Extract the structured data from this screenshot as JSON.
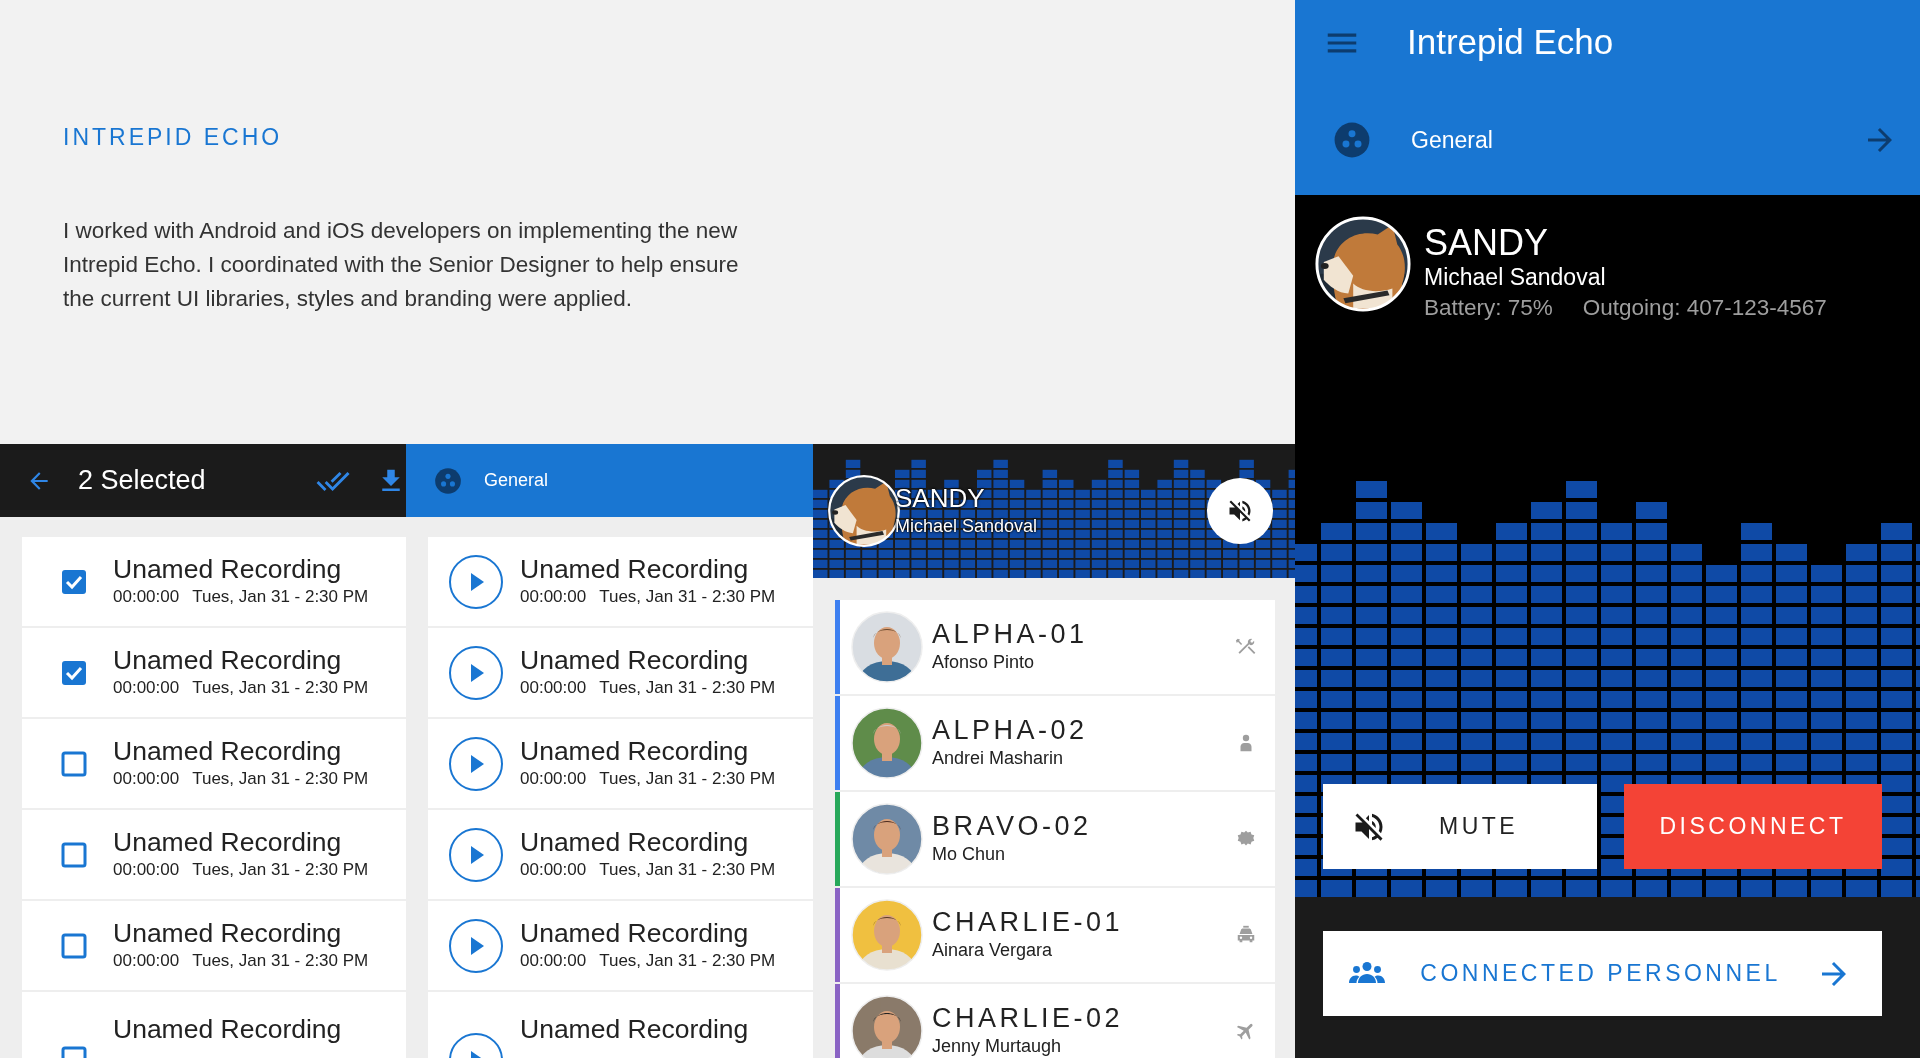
{
  "intro": {
    "heading": "INTREPID ECHO",
    "text": "I worked with Android and iOS developers on implementing the new Intrepid Echo. I coordinated with the Senior Designer to help ensure the current UI libraries, styles and branding were applied."
  },
  "selection_screen": {
    "title": "2 Selected",
    "recordings": [
      {
        "title": "Unamed Recording",
        "duration": "00:00:00",
        "date": "Tues, Jan 31 - 2:30 PM",
        "checked": true
      },
      {
        "title": "Unamed Recording",
        "duration": "00:00:00",
        "date": "Tues, Jan 31 - 2:30 PM",
        "checked": true
      },
      {
        "title": "Unamed Recording",
        "duration": "00:00:00",
        "date": "Tues, Jan 31 - 2:30 PM",
        "checked": false
      },
      {
        "title": "Unamed Recording",
        "duration": "00:00:00",
        "date": "Tues, Jan 31 - 2:30 PM",
        "checked": false
      },
      {
        "title": "Unamed Recording",
        "duration": "00:00:00",
        "date": "Tues, Jan 31 - 2:30 PM",
        "checked": false
      },
      {
        "title": "Unamed Recording",
        "checked": false
      }
    ]
  },
  "channel_screen": {
    "channel": "General",
    "recordings": [
      {
        "title": "Unamed Recording",
        "duration": "00:00:00",
        "date": "Tues, Jan 31 - 2:30 PM"
      },
      {
        "title": "Unamed Recording",
        "duration": "00:00:00",
        "date": "Tues, Jan 31 - 2:30 PM"
      },
      {
        "title": "Unamed Recording",
        "duration": "00:00:00",
        "date": "Tues, Jan 31 - 2:30 PM"
      },
      {
        "title": "Unamed Recording",
        "duration": "00:00:00",
        "date": "Tues, Jan 31 - 2:30 PM"
      },
      {
        "title": "Unamed Recording",
        "duration": "00:00:00",
        "date": "Tues, Jan 31 - 2:30 PM"
      },
      {
        "title": "Unamed Recording"
      }
    ]
  },
  "call_screen": {
    "callsign": "SANDY",
    "name": "Michael Sandoval",
    "personnel": [
      {
        "callsign": "ALPHA-01",
        "name": "Afonso Pinto",
        "color": "#3d7ff0",
        "kind": "tools"
      },
      {
        "callsign": "ALPHA-02",
        "name": "Andrei Masharin",
        "color": "#3d7ff0",
        "kind": "person"
      },
      {
        "callsign": "BRAVO-02",
        "name": "Mo Chun",
        "color": "#27a85a",
        "kind": "badge"
      },
      {
        "callsign": "CHARLIE-01",
        "name": "Ainara Vergara",
        "color": "#8a63c4",
        "kind": "car"
      },
      {
        "callsign": "CHARLIE-02",
        "name": "Jenny Murtaugh",
        "color": "#8a63c4",
        "kind": "plane"
      }
    ]
  },
  "main_screen": {
    "title": "Intrepid Echo",
    "channel": "General",
    "callsign": "SANDY",
    "name": "Michael Sandoval",
    "battery": "Battery: 75%",
    "outgoing": "Outgoing: 407-123-4567",
    "mute": "MUTE",
    "disconnect": "DISCONNECT",
    "personnel_button": "CONNECTED PERSONNEL"
  }
}
